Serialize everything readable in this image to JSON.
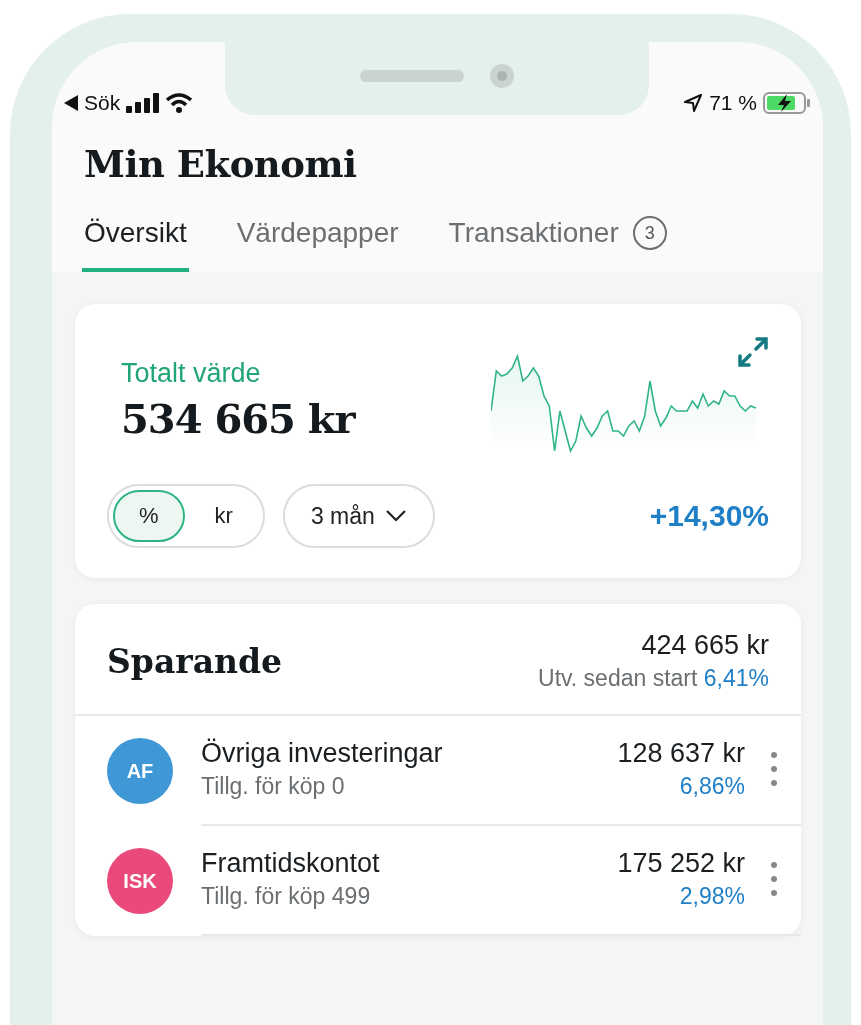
{
  "status_bar": {
    "back_label": "Sök",
    "battery": "71 %"
  },
  "title": "Min Ekonomi",
  "tabs": [
    {
      "label": "Översikt",
      "selected": true
    },
    {
      "label": "Värdepapper",
      "selected": false
    },
    {
      "label": "Transaktioner",
      "selected": false,
      "badge": "3"
    }
  ],
  "summary": {
    "label": "Totalt värde",
    "value": "534 665 kr",
    "unit_toggle": [
      {
        "label": "%",
        "selected": true
      },
      {
        "label": "kr",
        "selected": false
      }
    ],
    "period": "3 mån",
    "change": "+14,30%"
  },
  "savings": {
    "title": "Sparande",
    "total": "424 665 kr",
    "growth_label": "Utv. sedan start",
    "growth": "6,41%",
    "accounts": [
      {
        "badge": "AF",
        "color": "#3f97d6",
        "name": "Övriga investeringar",
        "sub": "Tillg. för köp 0",
        "amount": "128 637 kr",
        "change": "6,86%"
      },
      {
        "badge": "ISK",
        "color": "#ea4a7b",
        "name": "Framtidskontot",
        "sub": "Tillg. för köp 499",
        "amount": "175 252 kr",
        "change": "2,98%"
      }
    ]
  }
}
